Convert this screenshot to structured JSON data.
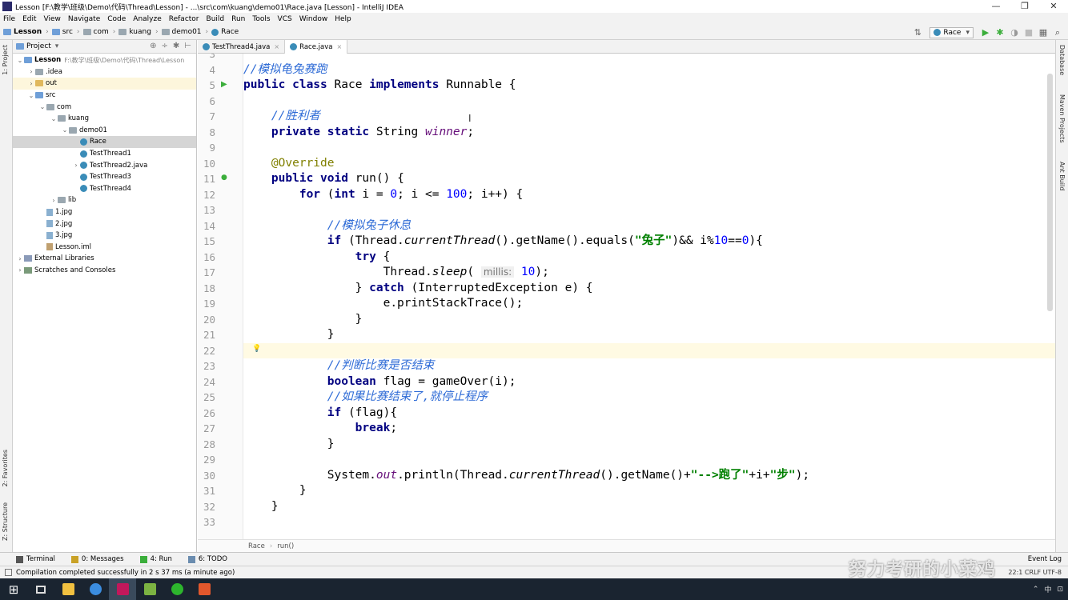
{
  "window": {
    "title": "Lesson [F:\\教学\\班级\\Demo\\代码\\Thread\\Lesson] - ...\\src\\com\\kuang\\demo01\\Race.java [Lesson] - IntelliJ IDEA",
    "minimize": "—",
    "maximize": "❐",
    "close": "✕"
  },
  "menu": [
    "File",
    "Edit",
    "View",
    "Navigate",
    "Code",
    "Analyze",
    "Refactor",
    "Build",
    "Run",
    "Tools",
    "VCS",
    "Window",
    "Help"
  ],
  "breadcrumb": [
    "Lesson",
    "src",
    "com",
    "kuang",
    "demo01",
    "Race"
  ],
  "toolbar": {
    "run_config": "Race",
    "run_icon": "▶",
    "debug_icon": "✱",
    "coverage_icon": "◑",
    "stop_icon": "■",
    "structure_icon": "▦",
    "search_icon": "⌕",
    "build_icon": "⇅"
  },
  "side_left": {
    "project": "1: Project",
    "favorites": "2: Favorites",
    "structure": "Z: Structure"
  },
  "side_right": {
    "database": "Database",
    "maven": "Maven Projects",
    "ant": "Ant Build"
  },
  "project_panel": {
    "title": "Project",
    "tools": [
      "⊕",
      "÷",
      "✱",
      "⊢"
    ],
    "tree": [
      {
        "label": "Lesson",
        "path": "F:\\教学\\班级\\Demo\\代码\\Thread\\Lesson",
        "indent": 0,
        "arrow": "⌄",
        "icon": "folder-blue",
        "bold": true
      },
      {
        "label": ".idea",
        "indent": 1,
        "arrow": "›",
        "icon": "folder"
      },
      {
        "label": "out",
        "indent": 1,
        "arrow": "›",
        "icon": "folder-yellow",
        "hl": true
      },
      {
        "label": "src",
        "indent": 1,
        "arrow": "⌄",
        "icon": "folder-blue"
      },
      {
        "label": "com",
        "indent": 2,
        "arrow": "⌄",
        "icon": "folder"
      },
      {
        "label": "kuang",
        "indent": 3,
        "arrow": "⌄",
        "icon": "folder"
      },
      {
        "label": "demo01",
        "indent": 4,
        "arrow": "⌄",
        "icon": "folder"
      },
      {
        "label": "Race",
        "indent": 5,
        "arrow": "",
        "icon": "class",
        "sel": true
      },
      {
        "label": "TestThread1",
        "indent": 5,
        "arrow": "",
        "icon": "class"
      },
      {
        "label": "TestThread2.java",
        "indent": 5,
        "arrow": "›",
        "icon": "class"
      },
      {
        "label": "TestThread3",
        "indent": 5,
        "arrow": "",
        "icon": "class"
      },
      {
        "label": "TestThread4",
        "indent": 5,
        "arrow": "",
        "icon": "class"
      },
      {
        "label": "lib",
        "indent": 3,
        "arrow": "›",
        "icon": "folder"
      },
      {
        "label": "1.jpg",
        "indent": 2,
        "arrow": "",
        "icon": "jpg"
      },
      {
        "label": "2.jpg",
        "indent": 2,
        "arrow": "",
        "icon": "jpg"
      },
      {
        "label": "3.jpg",
        "indent": 2,
        "arrow": "",
        "icon": "jpg"
      },
      {
        "label": "Lesson.iml",
        "indent": 2,
        "arrow": "",
        "icon": "iml"
      },
      {
        "label": "External Libraries",
        "indent": 0,
        "arrow": "›",
        "icon": "lib"
      },
      {
        "label": "Scratches and Consoles",
        "indent": 0,
        "arrow": "›",
        "icon": "scratch"
      }
    ]
  },
  "tabs": [
    {
      "label": "TestThread4.java",
      "active": false
    },
    {
      "label": "Race.java",
      "active": true
    }
  ],
  "editor": {
    "first_line": 3,
    "lines": [
      [],
      [
        [
          "//模拟龟兔赛跑",
          "cm"
        ]
      ],
      [
        [
          "public class ",
          "kw"
        ],
        [
          "Race ",
          ""
        ],
        [
          "implements ",
          "kw"
        ],
        [
          "Runnable {",
          ""
        ]
      ],
      [],
      [
        [
          "    //胜利者",
          "cm"
        ]
      ],
      [
        [
          "    private static ",
          "kw"
        ],
        [
          "String ",
          ""
        ],
        [
          "winner",
          "fld"
        ],
        [
          ";",
          ""
        ]
      ],
      [],
      [
        [
          "    @Override",
          "ann"
        ]
      ],
      [
        [
          "    public void ",
          "kw"
        ],
        [
          "run() {",
          ""
        ]
      ],
      [
        [
          "        for ",
          "kw"
        ],
        [
          "(",
          ""
        ],
        [
          "int ",
          "kw"
        ],
        [
          "i = ",
          ""
        ],
        [
          "0",
          "num"
        ],
        [
          "; i <= ",
          ""
        ],
        [
          "100",
          "num"
        ],
        [
          "; i++) {",
          ""
        ]
      ],
      [],
      [
        [
          "            //模拟兔子休息",
          "cm"
        ]
      ],
      [
        [
          "            if ",
          "kw"
        ],
        [
          "(Thread.",
          ""
        ],
        [
          "currentThread",
          "st"
        ],
        [
          "().getName().equals(",
          ""
        ],
        [
          "\"兔子\"",
          "str"
        ],
        [
          ")&& i%",
          ""
        ],
        [
          "10",
          "num"
        ],
        [
          "==",
          ""
        ],
        [
          "0",
          "num"
        ],
        [
          "){",
          ""
        ]
      ],
      [
        [
          "                try ",
          "kw"
        ],
        [
          "{",
          ""
        ]
      ],
      [
        [
          "                    Thread.",
          ""
        ],
        [
          "sleep",
          "st"
        ],
        [
          "( ",
          ""
        ],
        [
          "millis:",
          "hint"
        ],
        [
          " ",
          ""
        ],
        [
          "10",
          "num"
        ],
        [
          ");",
          ""
        ]
      ],
      [
        [
          "                } ",
          ""
        ],
        [
          "catch ",
          "kw"
        ],
        [
          "(InterruptedException e) {",
          ""
        ]
      ],
      [
        [
          "                    e.printStackTrace();",
          ""
        ]
      ],
      [
        [
          "                }",
          ""
        ]
      ],
      [
        [
          "            }",
          ""
        ]
      ],
      [],
      [
        [
          "            //判断比赛是否结束",
          "cm"
        ]
      ],
      [
        [
          "            boolean ",
          "kw"
        ],
        [
          "flag = gameOver(i);",
          ""
        ]
      ],
      [
        [
          "            //如果比赛结束了,就停止程序",
          "cm"
        ]
      ],
      [
        [
          "            if ",
          "kw"
        ],
        [
          "(flag){",
          ""
        ]
      ],
      [
        [
          "                break",
          "kw"
        ],
        [
          ";",
          ""
        ]
      ],
      [
        [
          "            }",
          ""
        ]
      ],
      [],
      [
        [
          "            System.",
          ""
        ],
        [
          "out",
          "fld"
        ],
        [
          ".println(Thread.",
          ""
        ],
        [
          "currentThread",
          "st"
        ],
        [
          "().getName()+",
          ""
        ],
        [
          "\"-->跑了\"",
          "str"
        ],
        [
          "+i+",
          ""
        ],
        [
          "\"步\"",
          "str"
        ],
        [
          ");",
          ""
        ]
      ],
      [
        [
          "        }",
          ""
        ]
      ],
      [
        [
          "    }",
          ""
        ]
      ],
      []
    ],
    "current_line": 22,
    "crumb": [
      "Race",
      "run()"
    ]
  },
  "toolwindows": [
    {
      "label": "Terminal",
      "icon": "terminal-icon"
    },
    {
      "label": "0: Messages",
      "icon": "messages-icon"
    },
    {
      "label": "4: Run",
      "icon": "run-icon"
    },
    {
      "label": "6: TODO",
      "icon": "todo-icon"
    }
  ],
  "event_log": "Event Log",
  "status": {
    "message": "Compilation completed successfully in 2 s 37 ms (a minute ago)",
    "right": "22:1  CRLF  UTF-8"
  },
  "watermark": "努力考研的小菜鸡",
  "taskbar": {
    "start": "⊞",
    "apps": [
      "explorer",
      "browser",
      "intellij",
      "notepad",
      "wechat",
      "slides"
    ],
    "tray": [
      "⌃",
      "中",
      "⊡"
    ]
  },
  "colors": {
    "accent_green": "#3bae3b",
    "comment_blue": "#2e6bd6",
    "keyword_navy": "#000080",
    "string_green": "#008000"
  }
}
